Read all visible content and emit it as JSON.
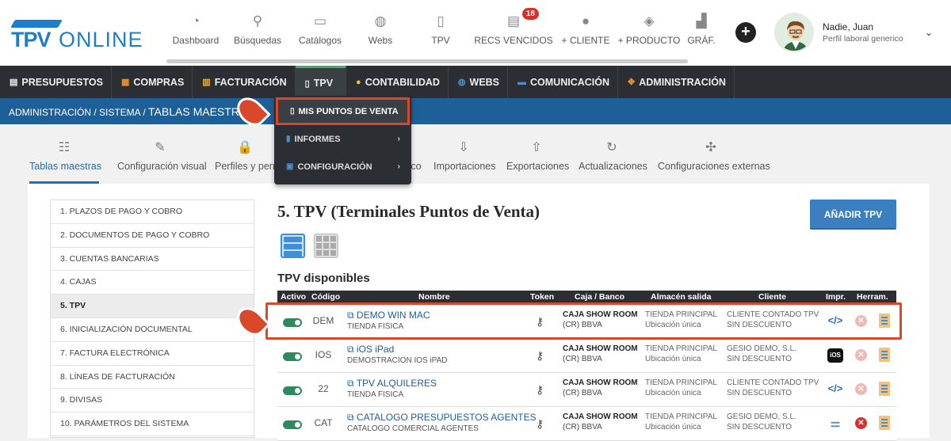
{
  "header": {
    "logo": {
      "tpv": "TPV",
      "online": "ONLINE"
    },
    "topnav": [
      {
        "label": "Dashboard",
        "icon": "gauge-icon"
      },
      {
        "label": "Búsquedas",
        "icon": "search-icon"
      },
      {
        "label": "Catálogos",
        "icon": "catalog-icon"
      },
      {
        "label": "Webs",
        "icon": "globe-icon"
      },
      {
        "label": "TPV",
        "icon": "pos-icon"
      },
      {
        "label": "RECS VENCIDOS",
        "icon": "invoice-icon",
        "badge": "18"
      },
      {
        "label": "+ CLIENTE",
        "icon": "user-icon"
      },
      {
        "label": "+ PRODUCTO",
        "icon": "box-icon"
      },
      {
        "label": "GRÁF.",
        "icon": "chart-icon"
      }
    ],
    "plus": "+",
    "user": {
      "name": "Nadie, Juan",
      "role": "Perfil laboral generico",
      "caret": "⌄"
    }
  },
  "mainnav": [
    {
      "label": "PRESUPUESTOS",
      "icon": "▤"
    },
    {
      "label": "COMPRAS",
      "icon": "▦"
    },
    {
      "label": "FACTURACIÓN",
      "icon": "▥"
    },
    {
      "label": "TPV",
      "icon": "▯",
      "active": true
    },
    {
      "label": "CONTABILIDAD",
      "icon": "●"
    },
    {
      "label": "WEBS",
      "icon": "◍"
    },
    {
      "label": "COMUNICACIÓN",
      "icon": "▬"
    },
    {
      "label": "ADMINISTRACIÓN",
      "icon": "✥"
    }
  ],
  "breadcrumb": {
    "path": "ADMINISTRACIÓN / SISTEMA /",
    "current": "TABLAS MAESTRAS"
  },
  "dropdown": [
    {
      "label": "MIS PUNTOS DE VENTA",
      "icon": "▯"
    },
    {
      "label": "INFORMES",
      "icon": "▮",
      "chevron": "›"
    },
    {
      "label": "CONFIGURACIÓN",
      "icon": "▣",
      "chevron": "›"
    }
  ],
  "tabs": [
    {
      "label": "Tablas maestras",
      "icon": "☷"
    },
    {
      "label": "Configuración visual",
      "icon": "✎"
    },
    {
      "label": "Perfiles y perm",
      "icon": "🔒"
    },
    {
      "label": "co",
      "icon": ""
    },
    {
      "label": "Importaciones",
      "icon": "⇩"
    },
    {
      "label": "Exportaciones",
      "icon": "⇧"
    },
    {
      "label": "Actualizaciones",
      "icon": "↻"
    },
    {
      "label": "Configuraciones externas",
      "icon": "✣"
    }
  ],
  "sidelist": [
    "1. PLAZOS DE PAGO Y COBRO",
    "2. DOCUMENTOS DE PAGO Y COBRO",
    "3. CUENTAS BANCARIAS",
    "4. CAJAS",
    "5. TPV",
    "6. INICIALIZACIÓN DOCUMENTAL",
    "7. FACTURA ELECTRÓNICA",
    "8. LÍNEAS DE FACTURACIÓN",
    "9. DIVISAS",
    "10. PARÁMETROS DEL SISTEMA"
  ],
  "main": {
    "title": "5. TPV (Terminales Puntos de Venta)",
    "add_button": "AÑADIR TPV",
    "section": "TPV disponibles",
    "columns": [
      "Activo",
      "Código",
      "Nombre",
      "Token",
      "Caja / Banco",
      "Almacén salida",
      "Cliente",
      "Impr.",
      "Herram."
    ],
    "rows": [
      {
        "code": "DEM",
        "name": "DEMO WIN MAC",
        "sub": "TIENDA FISICA",
        "caja": "CAJA SHOW ROOM",
        "banco": "(CR) BBVA",
        "alm": "TIENDA PRINCIPAL",
        "alm2": "Ubicación única",
        "cli": "CLIENTE CONTADO TPV",
        "cli2": "SIN DESCUENTO",
        "impr": "</>"
      },
      {
        "code": "IOS",
        "name": "iOS iPad",
        "sub": "DEMOSTRACION IOS iPAD",
        "caja": "CAJA SHOW ROOM",
        "banco": "(CR) BBVA",
        "alm": "TIENDA PRINCIPAL",
        "alm2": "Ubicación única",
        "cli": "GESIO DEMO, S.L.",
        "cli2": "SIN DESCUENTO",
        "impr": "iOS"
      },
      {
        "code": "22",
        "name": "TPV ALQUILERES",
        "sub": "TIENDA FISICA",
        "caja": "CAJA SHOW ROOM",
        "banco": "(CR) BBVA",
        "alm": "TIENDA PRINCIPAL",
        "alm2": "Ubicación única",
        "cli": "CLIENTE CONTADO TPV",
        "cli2": "SIN DESCUENTO",
        "impr": "</>"
      },
      {
        "code": "CAT",
        "name": "CATALOGO PRESUPUESTOS AGENTES",
        "sub": "CATALOGO COMERCIAL AGENTES",
        "caja": "CAJA SHOW ROOM",
        "banco": "(CR) BBVA",
        "alm": "TIENDA PRINCIPAL",
        "alm2": "Ubicación única",
        "cli": "GESIO DEMO, S.L.",
        "cli2": "SIN DESCUENTO",
        "impr": "⚌"
      }
    ]
  },
  "colors": {
    "brand": "#1e7fc8",
    "nav": "#2b2f33",
    "crumb": "#1f5f97",
    "highlight": "#d9482b",
    "toggle": "#2d8a5e"
  }
}
